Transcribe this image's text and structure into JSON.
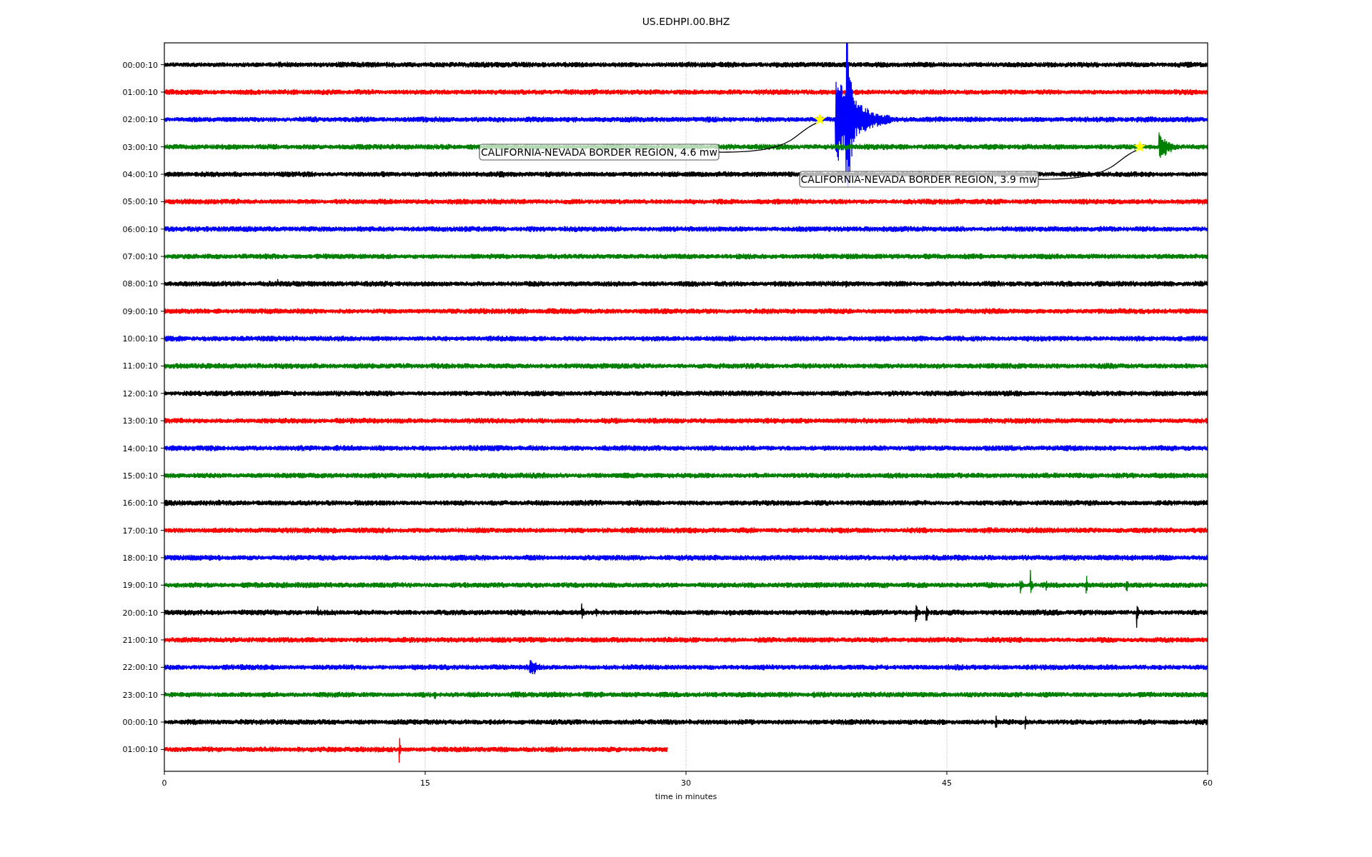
{
  "title": "US.EDHPI.00.BHZ",
  "xlabel": "time in minutes",
  "xticks": [
    "0",
    "15",
    "30",
    "45",
    "60"
  ],
  "traces": [
    {
      "label": "00:00:10",
      "color": "#000000",
      "kind": "full"
    },
    {
      "label": "01:00:10",
      "color": "#ff0000",
      "kind": "full"
    },
    {
      "label": "02:00:10",
      "color": "#0000ff",
      "kind": "full",
      "events": [
        {
          "label": "CALIFORNIA-NEVADA BORDER REGION, 4.6 mw"
        }
      ]
    },
    {
      "label": "03:00:10",
      "color": "#008000",
      "kind": "full",
      "events": [
        {
          "label": "CALIFORNIA-NEVADA BORDER REGION, 3.9 mw"
        }
      ]
    },
    {
      "label": "04:00:10",
      "color": "#000000",
      "kind": "full"
    },
    {
      "label": "05:00:10",
      "color": "#ff0000",
      "kind": "full"
    },
    {
      "label": "06:00:10",
      "color": "#0000ff",
      "kind": "full"
    },
    {
      "label": "07:00:10",
      "color": "#008000",
      "kind": "full"
    },
    {
      "label": "08:00:10",
      "color": "#000000",
      "kind": "full"
    },
    {
      "label": "09:00:10",
      "color": "#ff0000",
      "kind": "full"
    },
    {
      "label": "10:00:10",
      "color": "#0000ff",
      "kind": "full"
    },
    {
      "label": "11:00:10",
      "color": "#008000",
      "kind": "full"
    },
    {
      "label": "12:00:10",
      "color": "#000000",
      "kind": "full"
    },
    {
      "label": "13:00:10",
      "color": "#ff0000",
      "kind": "full"
    },
    {
      "label": "14:00:10",
      "color": "#0000ff",
      "kind": "full"
    },
    {
      "label": "15:00:10",
      "color": "#008000",
      "kind": "full"
    },
    {
      "label": "16:00:10",
      "color": "#000000",
      "kind": "full"
    },
    {
      "label": "17:00:10",
      "color": "#ff0000",
      "kind": "full"
    },
    {
      "label": "18:00:10",
      "color": "#0000ff",
      "kind": "full"
    },
    {
      "label": "19:00:10",
      "color": "#008000",
      "kind": "full"
    },
    {
      "label": "20:00:10",
      "color": "#000000",
      "kind": "full"
    },
    {
      "label": "21:00:10",
      "color": "#ff0000",
      "kind": "full"
    },
    {
      "label": "22:00:10",
      "color": "#0000ff",
      "kind": "full"
    },
    {
      "label": "23:00:10",
      "color": "#008000",
      "kind": "full"
    },
    {
      "label": "00:00:10",
      "color": "#000000",
      "kind": "full"
    },
    {
      "label": "01:00:10",
      "color": "#ff0000",
      "kind": "partial"
    }
  ]
}
